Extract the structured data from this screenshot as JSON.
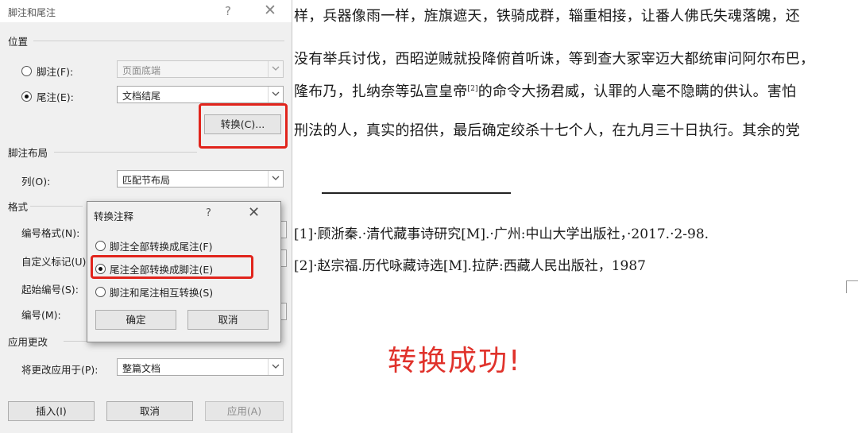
{
  "dialog": {
    "title": "脚注和尾注",
    "help": "?",
    "close": "✕",
    "position": {
      "section": "位置",
      "footnote_label": "脚注(F):",
      "footnote_value": "页面底端",
      "endnote_label": "尾注(E):",
      "endnote_value": "文档结尾",
      "convert_button": "转换(C)..."
    },
    "layout": {
      "section": "脚注布局",
      "columns_label": "列(O):",
      "columns_value": "匹配节布局"
    },
    "format": {
      "section": "格式",
      "number_format_label": "编号格式(N):",
      "custom_mark_label": "自定义标记(U):",
      "start_at_label": "起始编号(S):",
      "numbering_label": "编号(M):"
    },
    "apply": {
      "section": "应用更改",
      "apply_to_label": "将更改应用于(P):",
      "apply_to_value": "整篇文档"
    },
    "buttons": {
      "insert": "插入(I)",
      "cancel": "取消",
      "apply": "应用(A)"
    }
  },
  "convert_dialog": {
    "title": "转换注释",
    "help": "?",
    "close": "✕",
    "options": [
      "脚注全部转换成尾注(F)",
      "尾注全部转换成脚注(E)",
      "脚注和尾注相互转换(S)"
    ],
    "selected_index": 1,
    "ok": "确定",
    "cancel": "取消"
  },
  "document": {
    "lines": [
      "样，兵器像雨一样，旌旗遮天，铁骑成群，辎重相接，让番人佛氏失魂落魄，还",
      "没有举兵讨伐，西昭逆贼就投降俯首听诛，等到查大冢宰迈大都统审问阿尔布巴，",
      "隆布乃，扎纳奈等弘宣皇帝",
      "的命令大扬君威，认罪的人毫不隐瞒的供认。害怕",
      "刑法的人，真实的招供，最后确定绞杀十七个人，在九月三十日执行。其余的党"
    ],
    "footnote_ref": "[2]",
    "footnotes": [
      "[1]·顾浙秦.·清代藏事诗研究[M].·广州:中山大学出版社，·2017.·2-98.",
      "[2]·赵宗福.历代咏藏诗选[M].拉萨:西藏人民出版社，1987"
    ],
    "success_text": "转换成功!"
  },
  "colors": {
    "highlight": "#e1241c",
    "success": "#e0322b",
    "dialog_bg": "#f0f0f0"
  }
}
